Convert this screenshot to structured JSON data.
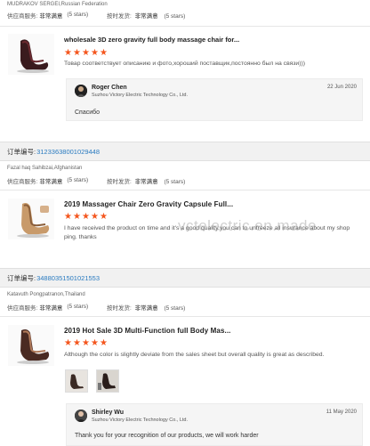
{
  "reviews": [
    {
      "buyer": "MUDRAKOV SERGEI,Russian Federation",
      "supplier_label": "供应商服务:",
      "supplier_value": "非常满意",
      "supplier_count": "(5 stars)",
      "delivery_label": "按时发货:",
      "delivery_value": "非常满意",
      "delivery_count": "(5 stars)",
      "title": "wholesale 3D zero gravity full body massage chair for...",
      "text": "Товар соответствует описанию и фото,хороший поставщик,постоянно был на связи)))",
      "reply": {
        "name": "Roger Chen",
        "company": "Suzhou Victory Electric Technology Co., Ltd.",
        "date": "22 Jun 2020",
        "message": "Спасибо"
      }
    },
    {
      "order_label": "订单编号:",
      "order_number": "31233638001029448",
      "buyer": "Fazal haq Sahibzai,Afghanistan",
      "supplier_label": "供应商服务:",
      "supplier_value": "非常满意",
      "supplier_count": "(5 stars)",
      "delivery_label": "按时发货:",
      "delivery_value": "非常满意",
      "delivery_count": "(5 stars)",
      "title": "2019 Massager Chair Zero Gravity Capsule Full...",
      "text": "I have received the product on time and it's a good quality,you can to unfreeze all insurance about my shop ping. thanks"
    },
    {
      "order_label": "订单编号:",
      "order_number": "34880351501021553",
      "buyer": "Katavuth Pongpatranon,Thailand",
      "supplier_label": "供应商服务:",
      "supplier_value": "非常满意",
      "supplier_count": "(5 stars)",
      "delivery_label": "按时发货:",
      "delivery_value": "非常满意",
      "delivery_count": "(5 stars)",
      "title": "2019 Hot Sale 3D Multi-Function full Body Mas...",
      "text": "Although the color is slightly deviate from the sales sheet but overall quality is great as described.",
      "reply": {
        "name": "Shirley Wu",
        "company": "Suzhou Victory Electric Technology Co., Ltd.",
        "date": "11 May 2020",
        "message": "Thank you for your recognition of our products, we will work harder"
      }
    }
  ],
  "rating_stars": 5,
  "watermark": "vctelectric.en.made",
  "colors": {
    "star": "#f4561e",
    "order_number": "#2a7bc0",
    "order_bar_bg": "#f1f1f1",
    "reply_bg": "#f5f5f5"
  }
}
